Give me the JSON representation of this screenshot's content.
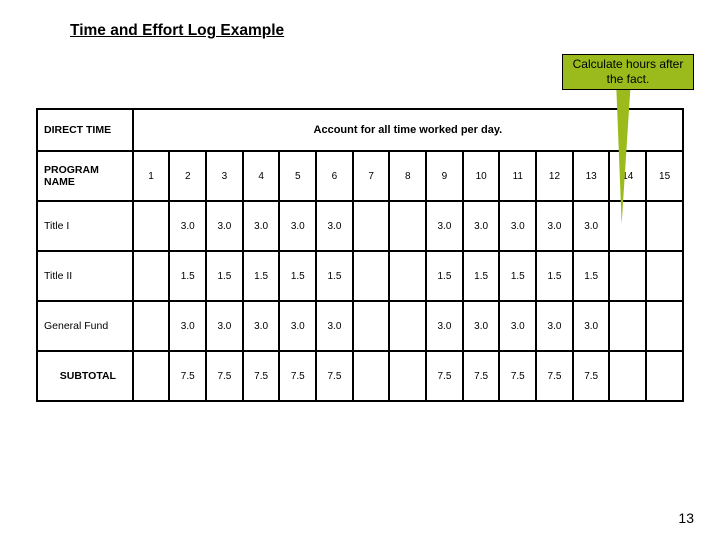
{
  "title": "Time and Effort Log Example",
  "callout_text": "Calculate hours after the fact.",
  "header": {
    "left_label": "DIRECT TIME",
    "right_instruction": "Account for all time worked per day.",
    "program_col": "PROGRAM NAME",
    "days": [
      "1",
      "2",
      "3",
      "4",
      "5",
      "6",
      "7",
      "8",
      "9",
      "10",
      "11",
      "12",
      "13",
      "14",
      "15"
    ]
  },
  "chart_data": {
    "type": "table",
    "columns": [
      "PROGRAM NAME",
      "1",
      "2",
      "3",
      "4",
      "5",
      "6",
      "7",
      "8",
      "9",
      "10",
      "11",
      "12",
      "13",
      "14",
      "15"
    ],
    "rows": [
      {
        "name": "Title I",
        "values": [
          "",
          "3.0",
          "3.0",
          "3.0",
          "3.0",
          "3.0",
          "",
          "",
          "3.0",
          "3.0",
          "3.0",
          "3.0",
          "3.0",
          "",
          ""
        ]
      },
      {
        "name": "Title II",
        "values": [
          "",
          "1.5",
          "1.5",
          "1.5",
          "1.5",
          "1.5",
          "",
          "",
          "1.5",
          "1.5",
          "1.5",
          "1.5",
          "1.5",
          "",
          ""
        ]
      },
      {
        "name": "General Fund",
        "values": [
          "",
          "3.0",
          "3.0",
          "3.0",
          "3.0",
          "3.0",
          "",
          "",
          "3.0",
          "3.0",
          "3.0",
          "3.0",
          "3.0",
          "",
          ""
        ]
      },
      {
        "name": "SUBTOTAL",
        "values": [
          "",
          "7.5",
          "7.5",
          "7.5",
          "7.5",
          "7.5",
          "",
          "",
          "7.5",
          "7.5",
          "7.5",
          "7.5",
          "7.5",
          "",
          ""
        ]
      }
    ]
  },
  "page_number": "13"
}
